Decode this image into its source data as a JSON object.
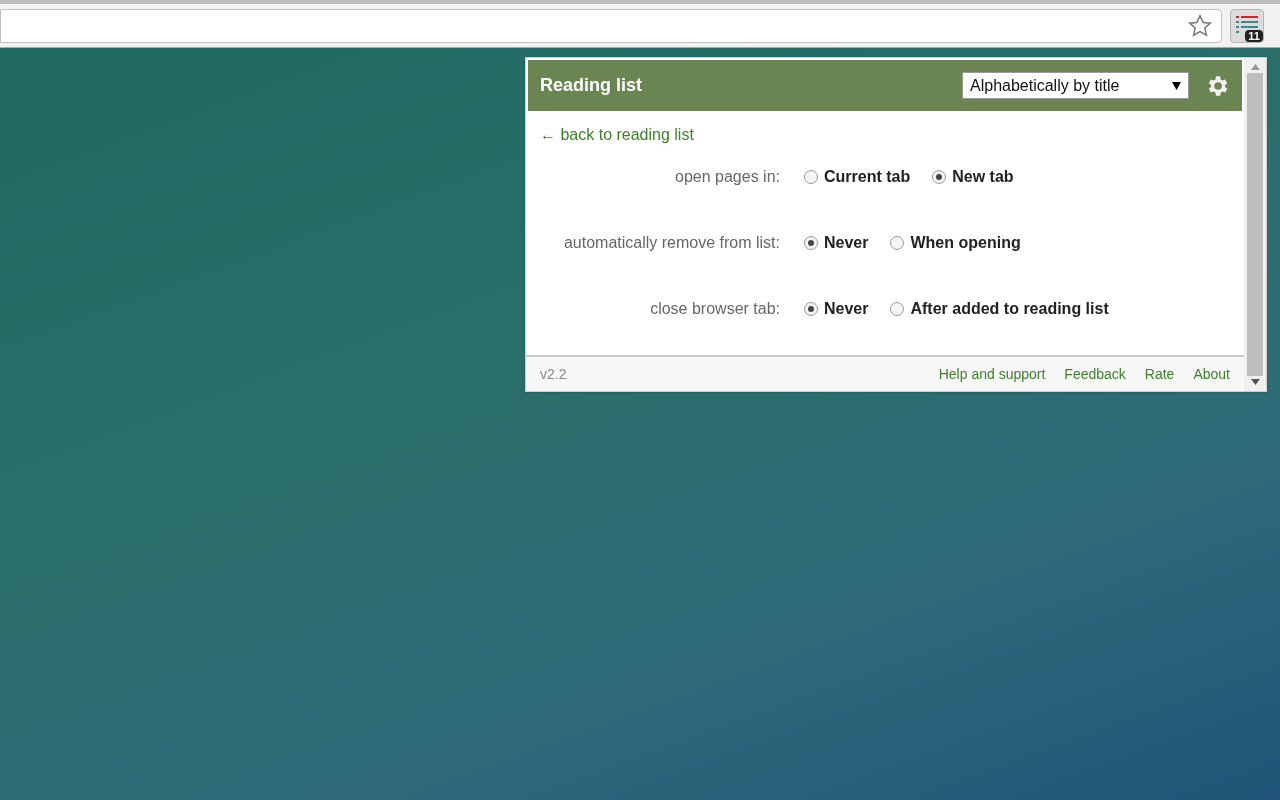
{
  "toolbar": {
    "badge": "11"
  },
  "popup": {
    "title": "Reading list",
    "sort": "Alphabetically by title",
    "back_link": "← back to reading list",
    "settings": [
      {
        "label": "open pages in:",
        "options": [
          {
            "label": "Current tab",
            "selected": false
          },
          {
            "label": "New tab",
            "selected": true
          }
        ]
      },
      {
        "label": "automatically remove from list:",
        "options": [
          {
            "label": "Never",
            "selected": true
          },
          {
            "label": "When opening",
            "selected": false
          }
        ]
      },
      {
        "label": "close browser tab:",
        "options": [
          {
            "label": "Never",
            "selected": true
          },
          {
            "label": "After added to reading list",
            "selected": false
          }
        ]
      }
    ],
    "footer": {
      "version": "v2.2",
      "links": [
        "Help and support",
        "Feedback",
        "Rate",
        "About"
      ]
    }
  }
}
